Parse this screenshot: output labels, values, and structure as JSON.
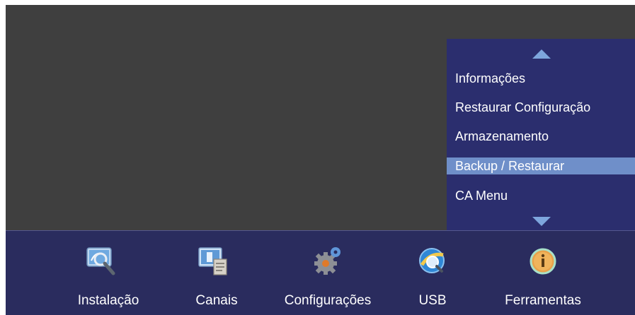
{
  "submenu": {
    "items": [
      {
        "label": "Informações"
      },
      {
        "label": "Restaurar Configuração"
      },
      {
        "label": "Armazenamento"
      },
      {
        "label": "Backup / Restaurar",
        "selected": true
      },
      {
        "label": "CA Menu"
      }
    ],
    "scroll_up_icon": "triangle-up",
    "scroll_down_icon": "triangle-down"
  },
  "bottombar": {
    "items": [
      {
        "label": "Instalação",
        "icon": "satellite-dish-search-icon"
      },
      {
        "label": "Canais",
        "icon": "channel-list-icon"
      },
      {
        "label": "Configurações",
        "icon": "gears-icon"
      },
      {
        "label": "USB",
        "icon": "globe-search-icon"
      },
      {
        "label": "Ferramentas",
        "icon": "info-icon"
      }
    ]
  },
  "colors": {
    "background": "#3f3f3f",
    "submenu_bg": "#2b2e6e",
    "selected_bg": "#6f8fc9",
    "bottombar_bg": "#2a2c5e",
    "arrow": "#7ea6dd"
  }
}
